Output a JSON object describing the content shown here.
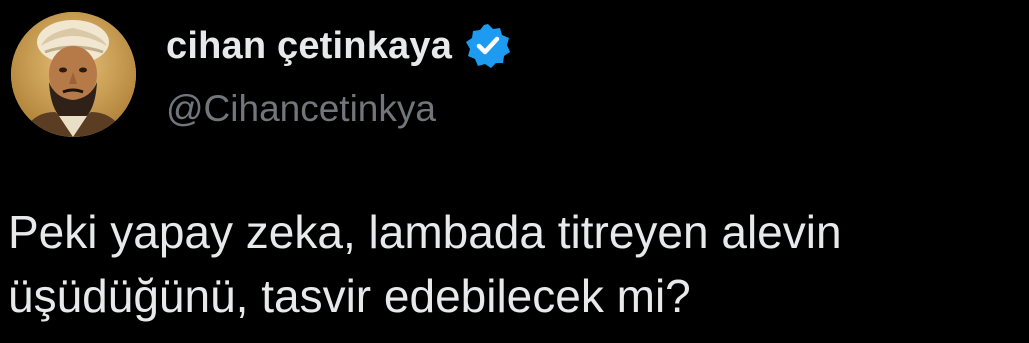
{
  "author": {
    "display_name": "cihan çetinkaya",
    "handle": "@Cihancetinkya",
    "verified": true,
    "avatar_icon": "portrait-avatar",
    "verified_icon": "verified-badge-icon",
    "verified_color": "#1d9bf0"
  },
  "tweet": {
    "lines": [
      "Peki yapay zeka, lambada titreyen alevin",
      "üşüdüğünü, tasvir edebilecek mi?"
    ]
  },
  "theme": {
    "background": "#000000",
    "primary_text": "#e7e9ea",
    "secondary_text": "#71767b"
  }
}
